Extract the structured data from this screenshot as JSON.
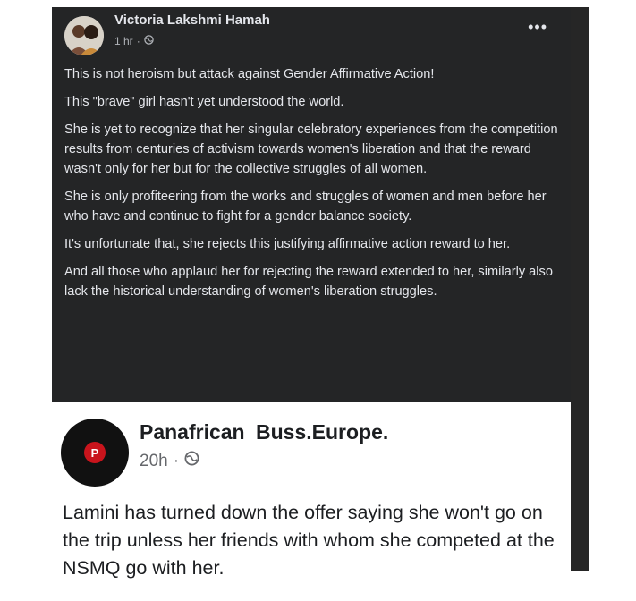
{
  "post": {
    "author": "Victoria Lakshmi Hamah",
    "time": "1 hr",
    "separator": "·",
    "more_label": "•••",
    "paragraphs": [
      "This is not heroism but attack against Gender Affirmative Action!",
      "This \"brave\" girl hasn't yet understood the world.",
      "She is yet to recognize that her singular celebratory experiences from the competition results from centuries of  activism towards women's liberation and that the reward wasn't only for her but for the collective struggles of all women.",
      "She is only  profiteering from the works and struggles of women and men before her who have and continue to fight for a gender balance society.",
      "It's unfortunate that, she rejects this  justifying affirmative action reward to her.",
      "And all those who applaud her for rejecting the reward extended to her, similarly also lack the historical understanding of women's liberation struggles."
    ]
  },
  "quoted": {
    "author": "Panafrican  Buss.Europe.",
    "time": "20h",
    "separator": "·",
    "logo_letter": "P",
    "text": "Lamini has turned down the offer saying she won't go on the trip unless her friends with whom she competed at the NSMQ go with her."
  },
  "colors": {
    "post_bg": "#242526",
    "post_text": "#e4e6eb",
    "meta_text": "#b0b3b8",
    "logo_red": "#c9141c"
  },
  "icons": {
    "privacy": "globe-icon",
    "more": "more-options-icon"
  }
}
